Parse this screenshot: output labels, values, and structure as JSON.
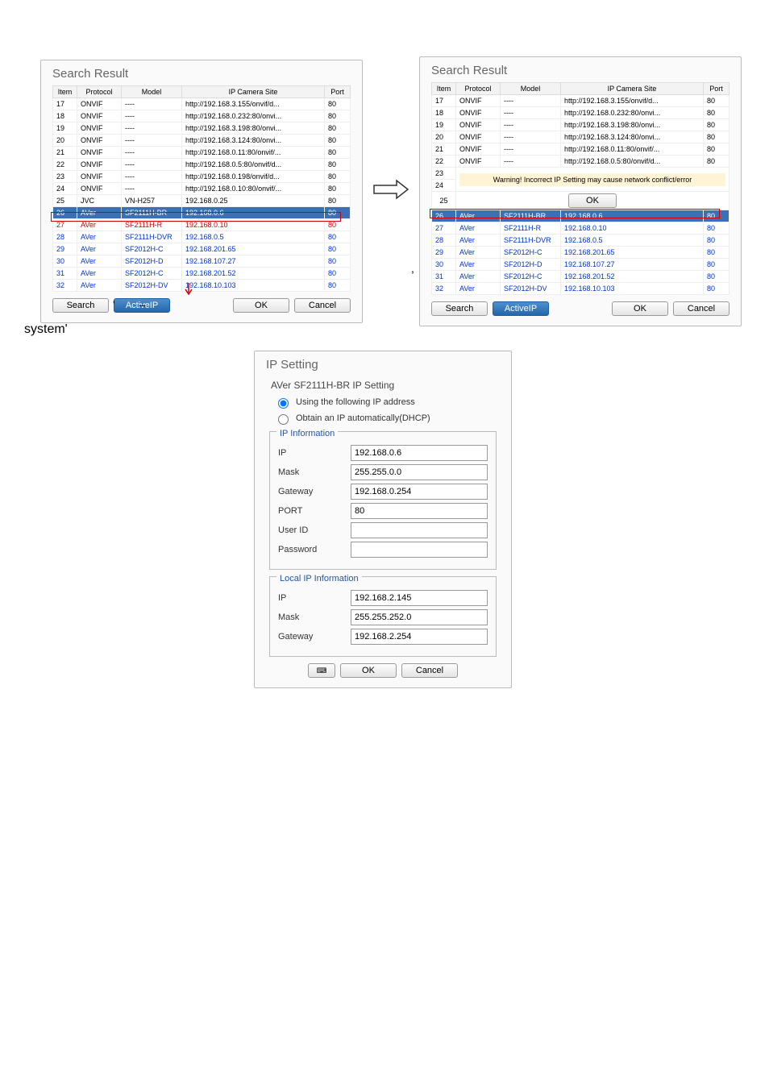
{
  "searchResult": {
    "title": "Search Result",
    "headers": [
      "Item",
      "Protocol",
      "Model",
      "IP Camera Site",
      "Port"
    ],
    "rows": [
      {
        "item": "17",
        "protocol": "ONVIF",
        "model": "----",
        "site": "http://192.168.3.155/onvif/d...",
        "port": "80"
      },
      {
        "item": "18",
        "protocol": "ONVIF",
        "model": "----",
        "site": "http://192.168.0.232:80/onvi...",
        "port": "80"
      },
      {
        "item": "19",
        "protocol": "ONVIF",
        "model": "----",
        "site": "http://192.168.3.198:80/onvi...",
        "port": "80"
      },
      {
        "item": "20",
        "protocol": "ONVIF",
        "model": "----",
        "site": "http://192.168.3.124:80/onvi...",
        "port": "80"
      },
      {
        "item": "21",
        "protocol": "ONVIF",
        "model": "----",
        "site": "http://192.168.0.11:80/onvif/...",
        "port": "80"
      },
      {
        "item": "22",
        "protocol": "ONVIF",
        "model": "----",
        "site": "http://192.168.0.5:80/onvif/d...",
        "port": "80"
      },
      {
        "item": "23",
        "protocol": "ONVIF",
        "model": "----",
        "site": "http://192.168.0.198/onvif/d...",
        "port": "80"
      },
      {
        "item": "24",
        "protocol": "ONVIF",
        "model": "----",
        "site": "http://192.168.0.10:80/onvif/...",
        "port": "80"
      },
      {
        "item": "25",
        "protocol": "JVC",
        "model": "VN-H257",
        "site": "192.168.0.25",
        "port": "80"
      }
    ],
    "selected": {
      "item": "26",
      "protocol": "AVer",
      "model": "SF2111H-BR",
      "site": "192.168.0.6",
      "port": "80"
    },
    "blueRows": [
      {
        "item": "27",
        "protocol": "AVer",
        "model": "SF2111H-R",
        "site": "192.168.0.10",
        "port": "80"
      },
      {
        "item": "28",
        "protocol": "AVer",
        "model": "SF2111H-DVR",
        "site": "192.168.0.5",
        "port": "80"
      },
      {
        "item": "29",
        "protocol": "AVer",
        "model": "SF2012H-C",
        "site": "192.168.201.65",
        "port": "80"
      },
      {
        "item": "30",
        "protocol": "AVer",
        "model": "SF2012H-D",
        "site": "192.168.107.27",
        "port": "80"
      },
      {
        "item": "31",
        "protocol": "AVer",
        "model": "SF2012H-C",
        "site": "192.168.201.52",
        "port": "80"
      },
      {
        "item": "32",
        "protocol": "AVer",
        "model": "SF2012H-DV",
        "site": "192.168.10.103",
        "port": "80"
      }
    ],
    "searchBtn": "Search",
    "activeIpBtn": "ActiveIP",
    "okBtn": "OK",
    "cancelBtn": "Cancel"
  },
  "warningPanel": {
    "warningText": "Warning! Incorrect IP Setting may cause network conflict/error",
    "okBtn": "OK"
  },
  "notes": {
    "comma": ",",
    "quote": "'",
    "dash": "–",
    "systemLabel": "system'"
  },
  "ipSetting": {
    "title": "IP Setting",
    "subtitle": "AVer SF2111H-BR IP Setting",
    "radio1": "Using the following IP address",
    "radio2": "Obtain an IP automatically(DHCP)",
    "ipInfoTitle": "IP Information",
    "ipLabel": "IP",
    "ipVal": "192.168.0.6",
    "maskLabel": "Mask",
    "maskVal": "255.255.0.0",
    "gatewayLabel": "Gateway",
    "gatewayVal": "192.168.0.254",
    "portLabel": "PORT",
    "portVal": "80",
    "userLabel": "User ID",
    "userVal": "",
    "passLabel": "Password",
    "passVal": "",
    "localInfoTitle": "Local IP Information",
    "localIpLabel": "IP",
    "localIpVal": "192.168.2.145",
    "localMaskLabel": "Mask",
    "localMaskVal": "255.255.252.0",
    "localGwLabel": "Gateway",
    "localGwVal": "192.168.2.254",
    "okBtn": "OK",
    "cancelBtn": "Cancel"
  }
}
